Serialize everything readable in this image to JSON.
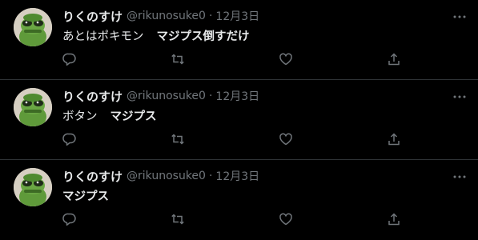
{
  "tweets": [
    {
      "author_name": "りくのすけ",
      "handle": "@rikunosuke0",
      "separator": "·",
      "time": "12月3日",
      "text_plain": "あとはポキモン",
      "text_bold": "マジプス倒すだけ"
    },
    {
      "author_name": "りくのすけ",
      "handle": "@rikunosuke0",
      "separator": "·",
      "time": "12月3日",
      "text_plain": "ボタン",
      "text_bold": "マジプス"
    },
    {
      "author_name": "りくのすけ",
      "handle": "@rikunosuke0",
      "separator": "·",
      "time": "12月3日",
      "text_plain": "",
      "text_bold": "マジプス"
    }
  ],
  "icons": [
    "more-icon",
    "reply-icon",
    "retweet-icon",
    "like-icon",
    "share-icon"
  ],
  "colors": {
    "background": "#000000",
    "text_primary": "#e7e9ea",
    "text_secondary": "#71767b",
    "divider": "#2f3336"
  }
}
